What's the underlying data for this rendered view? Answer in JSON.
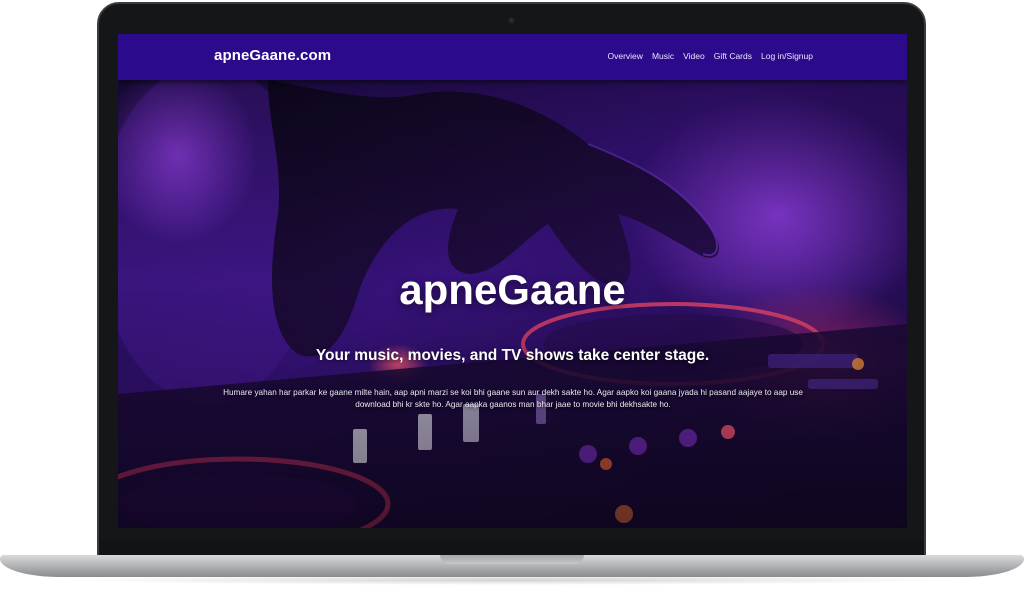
{
  "site": {
    "brand": "apneGaane.com",
    "nav": {
      "items": [
        {
          "label": "Overview"
        },
        {
          "label": "Music"
        },
        {
          "label": "Video"
        },
        {
          "label": "Gift Cards"
        },
        {
          "label": "Log in/Signup"
        }
      ]
    },
    "hero": {
      "title": "apneGaane",
      "subtitle": "Your music, movies, and TV shows take center stage.",
      "description": "Humare yahan har parkar ke gaane milte hain, aap apni marzi se koi bhi gaane sun aur dekh sakte ho. Agar aapko koi gaana jyada hi pasand aajaye to aap use download bhi kr skte ho. Agar aapka gaanos man bhar jaae to movie bhi dekhsakte ho.",
      "background_image": "dj-turntable-hand-purple-photo"
    }
  },
  "device": {
    "type": "laptop-mockup"
  },
  "colors": {
    "navbar": "#2c0a8c",
    "accent_purple": "#6a1fd0",
    "text": "#ffffff",
    "bezel": "#151617"
  }
}
